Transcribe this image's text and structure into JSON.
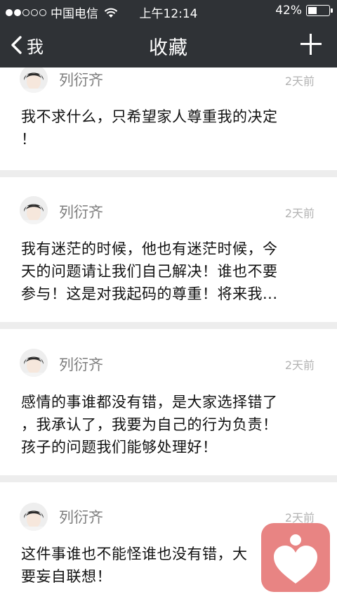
{
  "status": {
    "carrier": "中国电信",
    "time": "上午12:14",
    "battery_text": "42%",
    "battery_level": 0.42
  },
  "nav": {
    "back_label": "我",
    "title": "收藏"
  },
  "favorites": [
    {
      "author": "列衍齐",
      "date": "2天前",
      "lines": [
        "我不求什么，只希望家人尊重我的决定",
        "！"
      ]
    },
    {
      "author": "列衍齐",
      "date": "2天前",
      "lines": [
        "我有迷茫的时候，他也有迷茫时候，今",
        "天的问题请让我们自己解决！谁也不要",
        "参与！这是对我起码的尊重！将来我..."
      ]
    },
    {
      "author": "列衍齐",
      "date": "2天前",
      "lines": [
        "感情的事谁都没有错，是大家选择错了",
        "，我承认了，我要为自己的行为负责！",
        "孩子的问题我们能够处理好！"
      ]
    },
    {
      "author": "列衍齐",
      "date": "2天前",
      "lines": [
        "这件事谁也不能怪谁也没有错，大",
        "要妄自联想！"
      ]
    }
  ],
  "colors": {
    "header_bg": "#2f3236",
    "app_icon_bg": "#e88483",
    "list_bg": "#ededed"
  }
}
